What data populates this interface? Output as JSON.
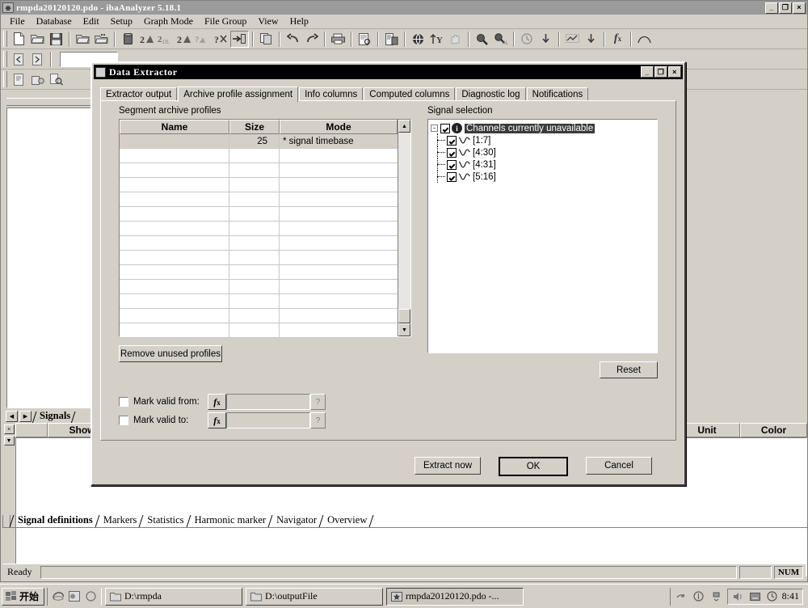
{
  "main_window": {
    "title": "rmpda20120120.pdo - ibaAnalyzer 5.18.1",
    "window_buttons": {
      "minimize": "_",
      "restore": "❐",
      "close": "×"
    },
    "menu": [
      "File",
      "Database",
      "Edit",
      "Setup",
      "Graph Mode",
      "File Group",
      "View",
      "Help"
    ]
  },
  "sheet_tabs": [
    {
      "label": "Signal definitions",
      "active": true
    },
    {
      "label": "Markers",
      "active": false
    },
    {
      "label": "Statistics",
      "active": false
    },
    {
      "label": "Harmonic marker",
      "active": false
    },
    {
      "label": "Navigator",
      "active": false
    },
    {
      "label": "Overview",
      "active": false
    }
  ],
  "signals_tab": {
    "label": "Signals"
  },
  "definitions_grid": {
    "columns": [
      "Show",
      "Unit",
      "Color"
    ]
  },
  "status_bar": {
    "message": "Ready",
    "num_indicator": "NUM"
  },
  "dialog": {
    "title": "Data Extractor",
    "window_buttons": {
      "minimize": "_",
      "maximize": "❐",
      "close": "×"
    },
    "tabs": [
      {
        "label": "Extractor output",
        "active": false
      },
      {
        "label": "Archive profile assignment",
        "active": true
      },
      {
        "label": "Info columns",
        "active": false
      },
      {
        "label": "Computed columns",
        "active": false
      },
      {
        "label": "Diagnostic log",
        "active": false
      },
      {
        "label": "Notifications",
        "active": false
      }
    ],
    "profiles": {
      "group_label": "Segment archive profiles",
      "columns": [
        "Name",
        "Size",
        "Mode"
      ],
      "rows": [
        {
          "name": "",
          "size": "25",
          "mode": "* signal timebase",
          "selected": true
        },
        {
          "name": "",
          "size": "",
          "mode": "",
          "selected": false
        },
        {
          "name": "",
          "size": "",
          "mode": "",
          "selected": false
        },
        {
          "name": "",
          "size": "",
          "mode": "",
          "selected": false
        },
        {
          "name": "",
          "size": "",
          "mode": "",
          "selected": false
        },
        {
          "name": "",
          "size": "",
          "mode": "",
          "selected": false
        },
        {
          "name": "",
          "size": "",
          "mode": "",
          "selected": false
        },
        {
          "name": "",
          "size": "",
          "mode": "",
          "selected": false
        },
        {
          "name": "",
          "size": "",
          "mode": "",
          "selected": false
        },
        {
          "name": "",
          "size": "",
          "mode": "",
          "selected": false
        },
        {
          "name": "",
          "size": "",
          "mode": "",
          "selected": false
        },
        {
          "name": "",
          "size": "",
          "mode": "",
          "selected": false
        },
        {
          "name": "",
          "size": "",
          "mode": "",
          "selected": false
        },
        {
          "name": "",
          "size": "",
          "mode": "",
          "selected": false
        }
      ],
      "remove_button": "Remove unused profiles"
    },
    "mark_valid_from": {
      "label": "Mark valid from:",
      "checked": false,
      "value": "",
      "fx": "fx",
      "help": "?"
    },
    "mark_valid_to": {
      "label": "Mark valid to:",
      "checked": false,
      "value": "",
      "fx": "fx",
      "help": "?"
    },
    "signal_selection": {
      "group_label": "Signal selection",
      "root": {
        "label": "Channels currently unavailable",
        "checked": true,
        "selected": true,
        "expander": "-"
      },
      "children": [
        {
          "label": "[1:7]",
          "checked": true
        },
        {
          "label": "[4:30]",
          "checked": true
        },
        {
          "label": "[4:31]",
          "checked": true
        },
        {
          "label": "[5:16]",
          "checked": true
        }
      ],
      "reset_button": "Reset"
    },
    "buttons": {
      "extract_now": "Extract now",
      "ok": "OK",
      "cancel": "Cancel"
    }
  },
  "taskbar": {
    "start_label": "开始",
    "tasks": [
      {
        "label": "D:\\rmpda",
        "active": false
      },
      {
        "label": "D:\\outputFile",
        "active": false
      },
      {
        "label": "rmpda20120120.pdo -...",
        "active": true
      }
    ],
    "clock": "8:41"
  }
}
